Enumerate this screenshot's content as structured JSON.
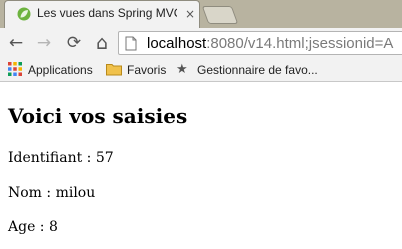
{
  "browser": {
    "tab_title": "Les vues dans Spring MVC",
    "tab_close": "×",
    "url_host": "localhost",
    "url_rest": ":8080/v14.html;jsessionid=A",
    "icons": {
      "back": "←",
      "forward": "→",
      "reload": "⟳",
      "home": "⌂",
      "star": "★"
    }
  },
  "bookmarks": [
    {
      "label": "Applications"
    },
    {
      "label": "Favoris"
    },
    {
      "label": "Gestionnaire de favo..."
    }
  ],
  "page": {
    "heading": "Voici vos saisies",
    "lines": [
      "Identifiant : 57",
      "Nom : milou",
      "Age : 8"
    ]
  },
  "colors": {
    "tab_strip": "#b8b3a0",
    "toolbar": "#f2f2f2",
    "spring_leaf": "#6db33f",
    "folder": "#f0c14b"
  }
}
